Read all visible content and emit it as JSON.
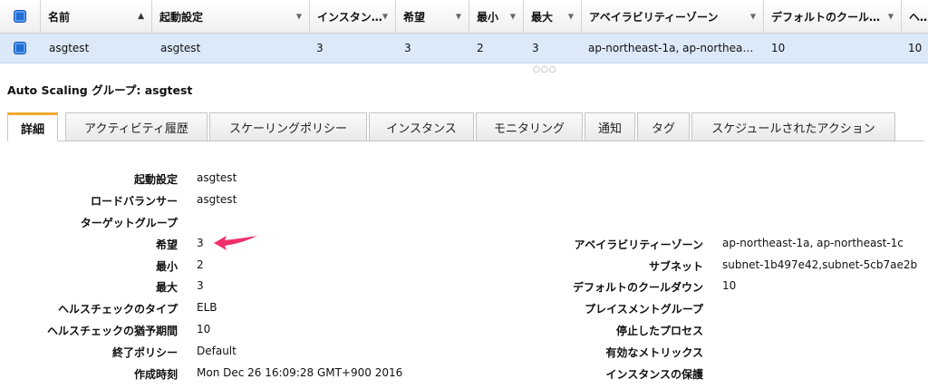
{
  "table": {
    "headers": [
      {
        "label": "",
        "type": "checkbox"
      },
      {
        "label": "名前",
        "sort": "asc"
      },
      {
        "label": "起動設定",
        "sort": "desc"
      },
      {
        "label": "インスタン…",
        "sort": "desc"
      },
      {
        "label": "希望",
        "sort": "desc"
      },
      {
        "label": "最小",
        "sort": "desc"
      },
      {
        "label": "最大",
        "sort": "desc"
      },
      {
        "label": "アベイラビリティーゾーン",
        "sort": "desc"
      },
      {
        "label": "デフォルトのクールダ…",
        "sort": "desc"
      },
      {
        "label": "ヘル",
        "sort": "none"
      }
    ],
    "rows": [
      {
        "selected": true,
        "cells": [
          "asgtest",
          "asgtest",
          "3",
          "3",
          "2",
          "3",
          "ap-northeast-1a, ap-northea…",
          "10",
          "10"
        ]
      }
    ]
  },
  "group_title": "Auto Scaling グループ: asgtest",
  "tabs": [
    {
      "label": "詳細",
      "active": true
    },
    {
      "label": "アクティビティ履歴"
    },
    {
      "label": "スケーリングポリシー"
    },
    {
      "label": "インスタンス"
    },
    {
      "label": "モニタリング"
    },
    {
      "label": "通知"
    },
    {
      "label": "タグ"
    },
    {
      "label": "スケジュールされたアクション"
    }
  ],
  "details_left": [
    {
      "label": "起動設定",
      "value": "asgtest"
    },
    {
      "label": "ロードバランサー",
      "value": "asgtest"
    },
    {
      "label": "ターゲットグループ",
      "value": ""
    },
    {
      "label": "希望",
      "value": "3"
    },
    {
      "label": "最小",
      "value": "2"
    },
    {
      "label": "最大",
      "value": "3"
    },
    {
      "label": "ヘルスチェックのタイプ",
      "value": "ELB"
    },
    {
      "label": "ヘルスチェックの猶予期間",
      "value": "10"
    },
    {
      "label": "終了ポリシー",
      "value": "Default"
    },
    {
      "label": "作成時刻",
      "value": "Mon Dec 26 16:09:28 GMT+900 2016"
    }
  ],
  "details_right": [
    {
      "label": "アベイラビリティーゾーン",
      "value": "ap-northeast-1a, ap-northeast-1c"
    },
    {
      "label": "サブネット",
      "value": "subnet-1b497e42,subnet-5cb7ae2b"
    },
    {
      "label": "デフォルトのクールダウン",
      "value": "10"
    },
    {
      "label": "プレイスメントグループ",
      "value": ""
    },
    {
      "label": "停止したプロセス",
      "value": ""
    },
    {
      "label": "有効なメトリックス",
      "value": ""
    },
    {
      "label": "インスタンスの保護",
      "value": ""
    }
  ],
  "colors": {
    "accent_tab": "#f0a830",
    "selected_row": "#dbe9f8",
    "checkbox": "#1f6fd6",
    "annotation_arrow": "#f0306a"
  },
  "annotation": {
    "icon": "arrow-left-icon",
    "points_to": "希望"
  }
}
